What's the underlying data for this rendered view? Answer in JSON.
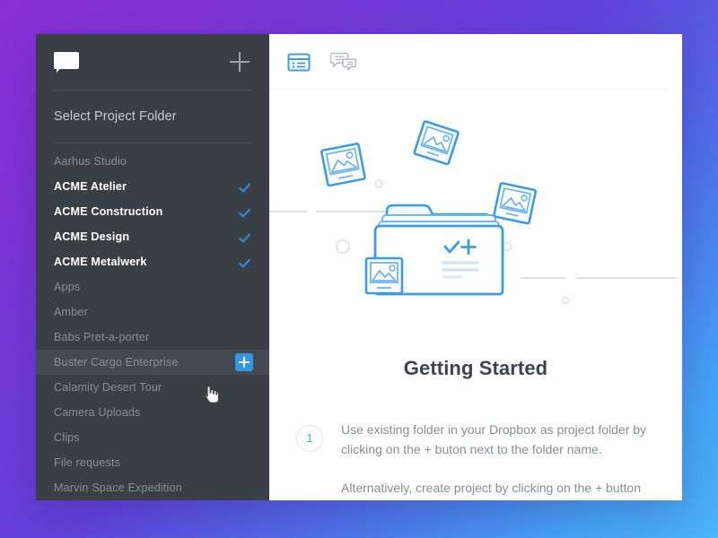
{
  "background": {
    "gradient_from": "#8a2fd8",
    "gradient_mid": "#5a4dd8",
    "gradient_to": "#4cb4f9"
  },
  "sidebar": {
    "logo_icon": "chat-bubble-icon",
    "add_icon": "plus-icon",
    "title": "Select Project Folder",
    "accent_color": "#2f97e8",
    "background_color": "#383f45",
    "items": [
      {
        "label": "Aarhus Studio",
        "selected": false,
        "hovered": false
      },
      {
        "label": "ACME Atelier",
        "selected": true,
        "hovered": false
      },
      {
        "label": "ACME Construction",
        "selected": true,
        "hovered": false
      },
      {
        "label": "ACME Design",
        "selected": true,
        "hovered": false
      },
      {
        "label": "ACME Metalwerk",
        "selected": true,
        "hovered": false
      },
      {
        "label": "Apps",
        "selected": false,
        "hovered": false
      },
      {
        "label": "Amber",
        "selected": false,
        "hovered": false
      },
      {
        "label": "Babs Pret-a-porter",
        "selected": false,
        "hovered": false
      },
      {
        "label": "Buster Cargo Enterprise",
        "selected": false,
        "hovered": true
      },
      {
        "label": "Calamity Desert Tour",
        "selected": false,
        "hovered": false
      },
      {
        "label": "Camera Uploads",
        "selected": false,
        "hovered": false
      },
      {
        "label": "Clips",
        "selected": false,
        "hovered": false
      },
      {
        "label": "File requests",
        "selected": false,
        "hovered": false
      },
      {
        "label": "Marvin Space Expedition",
        "selected": false,
        "hovered": false
      }
    ]
  },
  "main": {
    "tabs": [
      {
        "icon": "folder-list-icon",
        "active": true
      },
      {
        "icon": "comments-icon",
        "active": false
      }
    ],
    "illustration": "folder-with-photos-illustration",
    "heading": "Getting Started",
    "steps": [
      {
        "number": "1",
        "lines": [
          "Use existing folder in your Dropbox as project folder by clicking on the + buton next to the folder name.",
          "Alternatively, create project by clicking on the + button"
        ]
      }
    ]
  }
}
